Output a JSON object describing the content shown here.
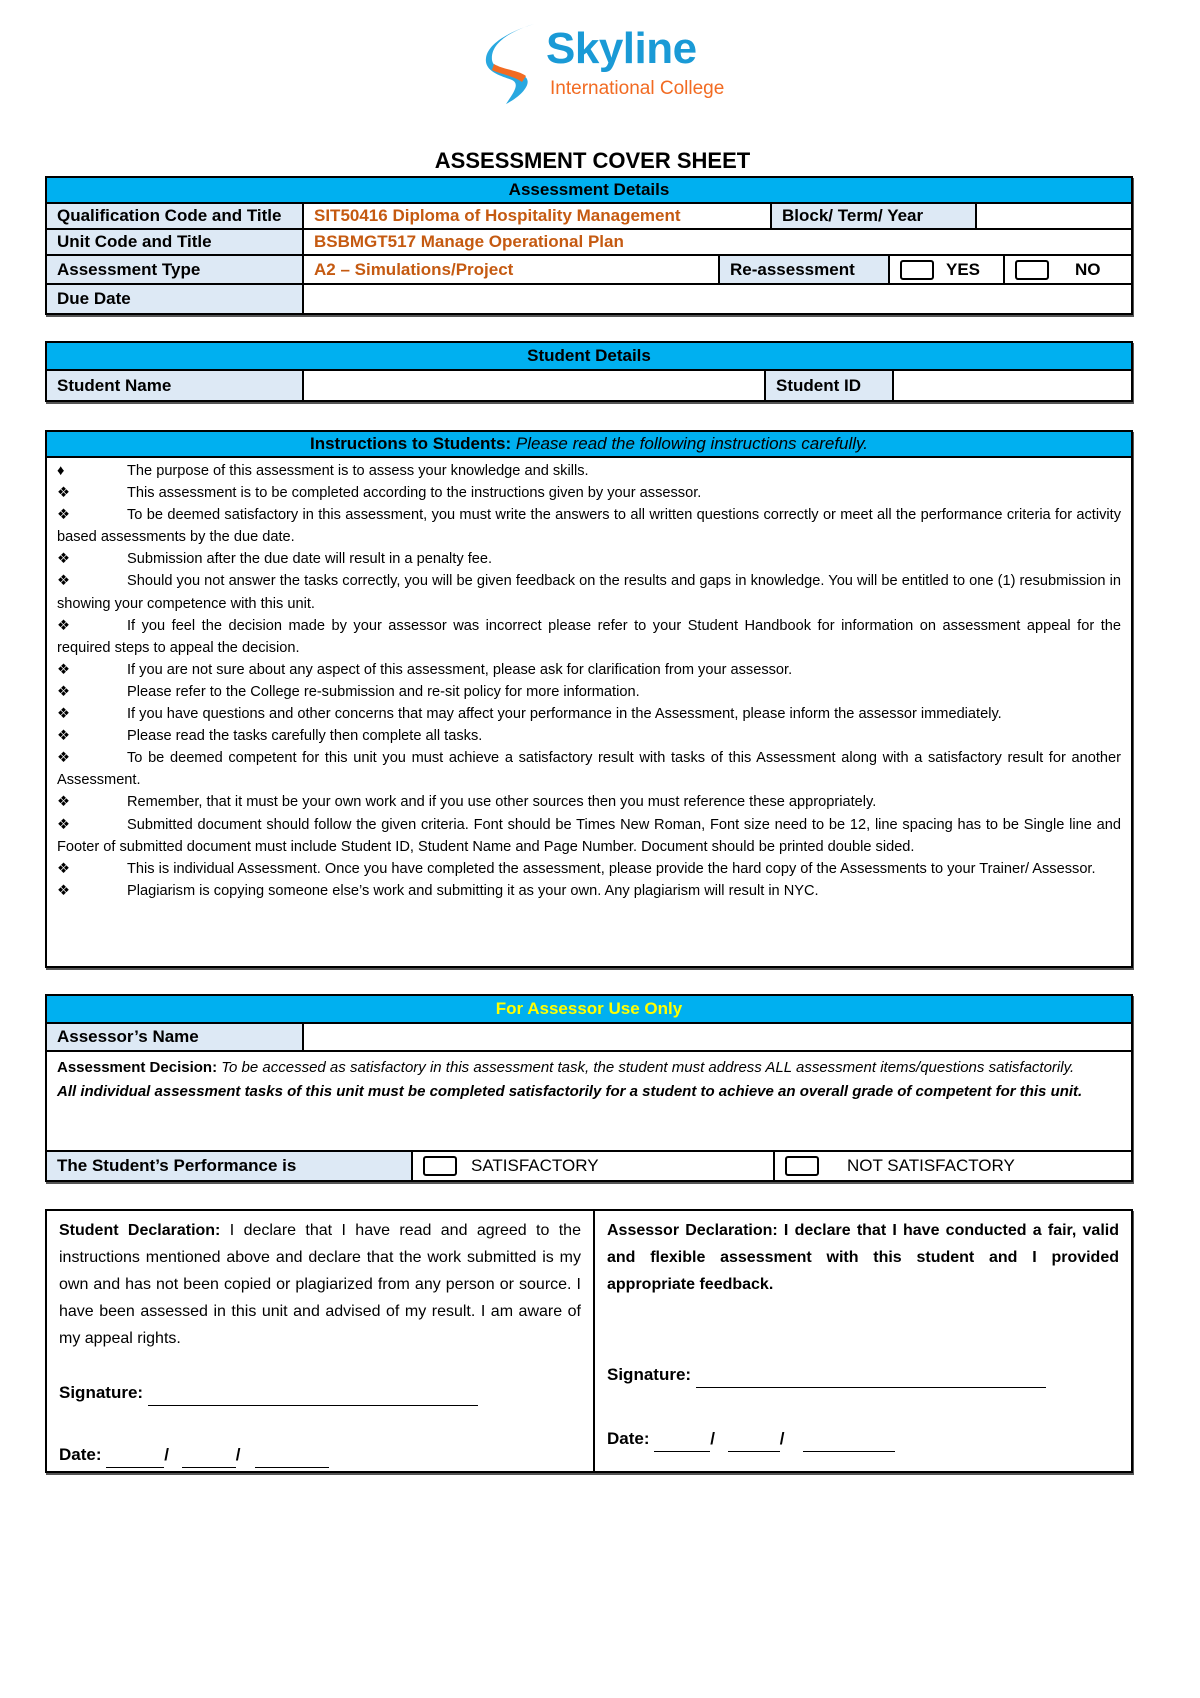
{
  "logo": {
    "name": "Skyline",
    "subtitle": "International College",
    "colors": {
      "blue": "#1a9ad6",
      "orange": "#f26b22"
    }
  },
  "title": "ASSESSMENT COVER SHEET",
  "assessment_details": {
    "header": "Assessment Details",
    "qualification_label": "Qualification Code and Title",
    "qualification_value": "SIT50416 Diploma of Hospitality Management",
    "block_label": "Block/ Term/ Year",
    "block_value": "",
    "unit_label": "Unit Code and Title",
    "unit_value": "BSBMGT517 Manage Operational Plan",
    "type_label": "Assessment Type",
    "type_value": "A2 – Simulations/Project",
    "reassessment_label": "Re-assessment",
    "yes_label": "YES",
    "no_label": "NO",
    "due_label": "Due Date",
    "due_value": ""
  },
  "student_details": {
    "header": "Student Details",
    "name_label": "Student Name",
    "name_value": "",
    "id_label": "Student ID",
    "id_value": ""
  },
  "instructions": {
    "header_bold": "Instructions to Students:",
    "header_italic": "Please read the following instructions carefully.",
    "items": [
      {
        "bullet": "♦",
        "text": "The purpose of this assessment is to assess your knowledge and skills."
      },
      {
        "bullet": "❖",
        "text": "This assessment is to be completed according to the instructions given by your assessor."
      },
      {
        "bullet": "❖",
        "text": "To be deemed satisfactory in this assessment, you must write the answers to all written questions correctly or meet all the performance criteria for activity based assessments by the due date."
      },
      {
        "bullet": "❖",
        "text": "Submission after the due date will result in a penalty fee."
      },
      {
        "bullet": "❖",
        "text": "Should you not answer the tasks correctly, you will be given feedback on the results and gaps in knowledge. You will be entitled to one (1) resubmission in showing your competence with this unit."
      },
      {
        "bullet": "❖",
        "text": "If you feel the decision made by your assessor was incorrect please refer to your Student Handbook for information on assessment appeal for the required steps to appeal the decision."
      },
      {
        "bullet": "❖",
        "text": "If you are not sure about any aspect of this assessment, please ask for clarification from your assessor."
      },
      {
        "bullet": "❖",
        "text": "Please refer to the College re-submission and re-sit policy for more information."
      },
      {
        "bullet": "❖",
        "text": "If you have questions and other concerns that may affect your performance in the Assessment, please inform the assessor immediately."
      },
      {
        "bullet": "❖",
        "text": "Please read the tasks carefully then complete all tasks."
      },
      {
        "bullet": "❖",
        "text": "To be deemed competent for this unit you must achieve a satisfactory result with tasks of this Assessment along with a satisfactory result for another Assessment."
      },
      {
        "bullet": "❖",
        "text": "Remember, that it must be your own work and if you use other sources then you must reference these appropriately."
      },
      {
        "bullet": "❖",
        "text": "Submitted document should follow the given criteria. Font should be Times New Roman, Font size need to be 12, line spacing has to be Single line and Footer of submitted document must include Student ID, Student Name and Page Number. Document should be printed double sided."
      },
      {
        "bullet": "❖",
        "text": "This is individual Assessment. Once you have completed the assessment, please provide the hard copy of the Assessments to your Trainer/ Assessor."
      },
      {
        "bullet": "❖",
        "text": "Plagiarism is copying someone else’s work and submitting it as your own. Any plagiarism will result in NYC."
      }
    ]
  },
  "assessor": {
    "header": "For Assessor Use Only",
    "header_color": "#ffff00",
    "name_label": "Assessor’s Name",
    "name_value": "",
    "decision_label": "Assessment Decision:",
    "decision_text": "To be accessed as satisfactory in this assessment task, the student must address ALL assessment items/questions satisfactorily.",
    "decision_note": "All individual assessment tasks of this unit must be completed satisfactorily for a student to achieve an overall grade of competent for this unit.",
    "performance_label": "The Student’s Performance is",
    "satisfactory_label": "SATISFACTORY",
    "not_satisfactory_label": "NOT SATISFACTORY"
  },
  "declarations": {
    "student_label": "Student Declaration:",
    "student_text": "I declare that I have read and agreed to the instructions mentioned above and declare that the work submitted is my own and has not been copied or plagiarized from any person or source. I have been assessed in this unit and advised of my result. I am aware of my appeal rights.",
    "assessor_label": "Assessor Declaration:",
    "assessor_text": "I declare that I have conducted a fair, valid and flexible assessment with this student and I provided appropriate feedback.",
    "signature_label": "Signature:",
    "date_label": "Date:"
  }
}
